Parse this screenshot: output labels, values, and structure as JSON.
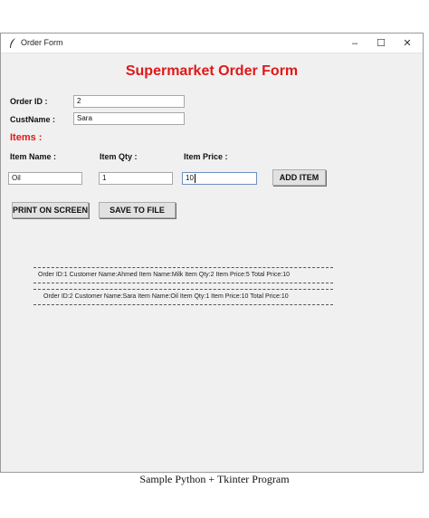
{
  "window": {
    "title": "Order Form",
    "minimize": "–",
    "maximize": "☐",
    "close": "✕"
  },
  "form": {
    "title": "Supermarket Order Form",
    "order_id_label": "Order ID :",
    "order_id_value": "2",
    "custname_label": "CustName :",
    "custname_value": "Sara",
    "items_label": "Items :",
    "item_name_label": "Item Name :",
    "item_qty_label": "Item Qty :",
    "item_price_label": "Item Price :",
    "item_name_value": "Oil",
    "item_qty_value": "1",
    "item_price_value": "10",
    "add_item_button": "ADD ITEM",
    "print_button": "PRINT ON SCREEN",
    "save_button": "SAVE TO FILE"
  },
  "records": [
    "Order ID:1   Customer Name:Ahmed  Item Name:Milk  Item Qty:2  Item Price:5  Total Price:10",
    "Order ID:2   Customer Name:Sara  Item Name:Oil  Item Qty:1  Item Price:10  Total Price:10"
  ],
  "caption": "Sample Python + Tkinter Program"
}
